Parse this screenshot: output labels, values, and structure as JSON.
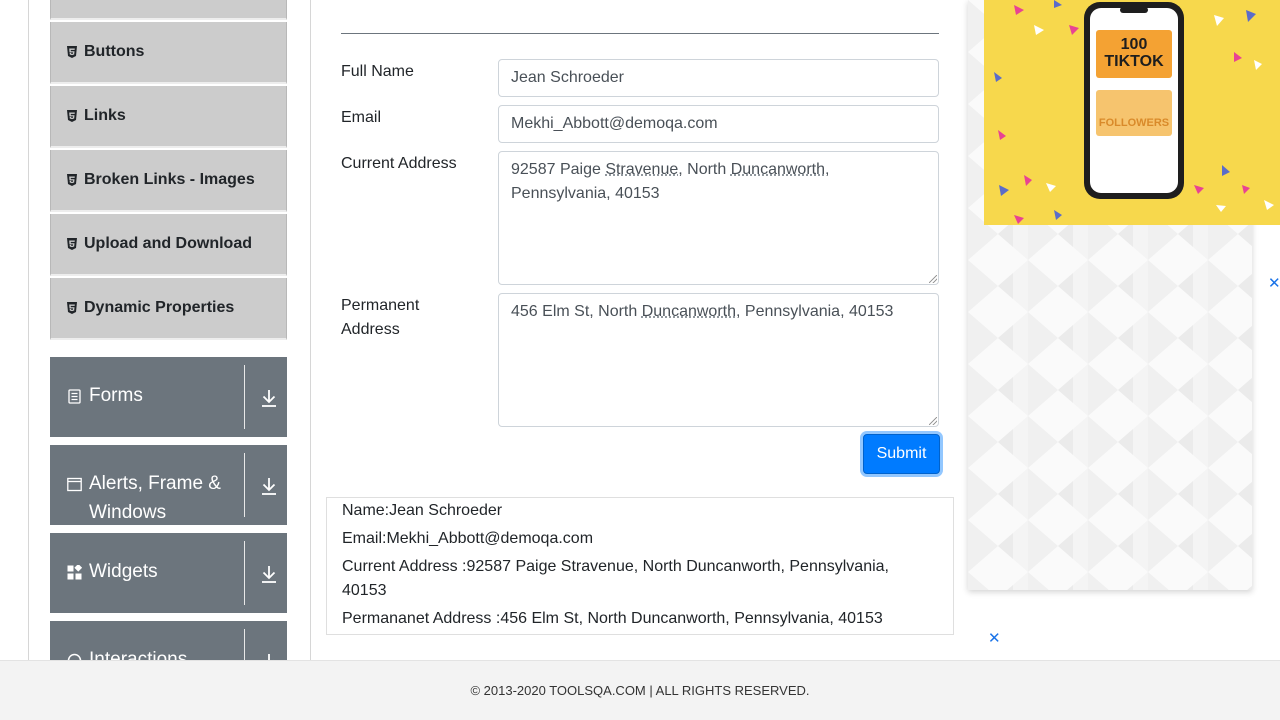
{
  "sidebar": {
    "element_items": [
      {
        "label": "Buttons"
      },
      {
        "label": "Links"
      },
      {
        "label": "Broken Links - Images"
      },
      {
        "label": "Upload and Download"
      },
      {
        "label": "Dynamic Properties"
      }
    ],
    "groups": [
      {
        "label": "Forms",
        "icon": "form-icon"
      },
      {
        "label": "Alerts, Frame & Windows",
        "icon": "window-icon"
      },
      {
        "label": "Widgets",
        "icon": "widgets-icon"
      },
      {
        "label": "Interactions",
        "icon": "interactions-icon"
      }
    ]
  },
  "form": {
    "full_name_label": "Full Name",
    "full_name_value": "Jean Schroeder",
    "email_label": "Email",
    "email_value": "Mekhi_Abbott@demoqa.com",
    "current_address_label": "Current Address",
    "current_address_parts": [
      "92587 Paige ",
      "Stravenue",
      ", North ",
      "Duncanworth",
      ",",
      "Pennsylvania, 40153"
    ],
    "permanent_address_label_1": "Permanent",
    "permanent_address_label_2": "Address",
    "permanent_address_parts": [
      "456 Elm St, North ",
      "Duncanworth",
      ", Pennsylvania, 40153"
    ],
    "submit_label": "Submit"
  },
  "output": {
    "name": "Name:Jean Schroeder",
    "email": "Email:Mekhi_Abbott@demoqa.com",
    "current_address_1": "Current Address :92587 Paige Stravenue, North Duncanworth, Pennsylvania,",
    "current_address_2": "40153",
    "permanent_address": "Permananet Address :456 Elm St, North Duncanworth, Pennsylvania, 40153"
  },
  "ad": {
    "line1": "100",
    "line2": "TIKTOK",
    "line3": "FOLLOWERS",
    "close_glyph": "✕"
  },
  "footer": {
    "text": "© 2013-2020 TOOLSQA.COM | ALL RIGHTS RESERVED."
  },
  "colors": {
    "group_bg": "#6c757d",
    "menu_bg": "#cccccc",
    "submit_bg": "#007bff",
    "ad_yellow": "#f7d84c",
    "ad_orange": "#f4a233"
  }
}
